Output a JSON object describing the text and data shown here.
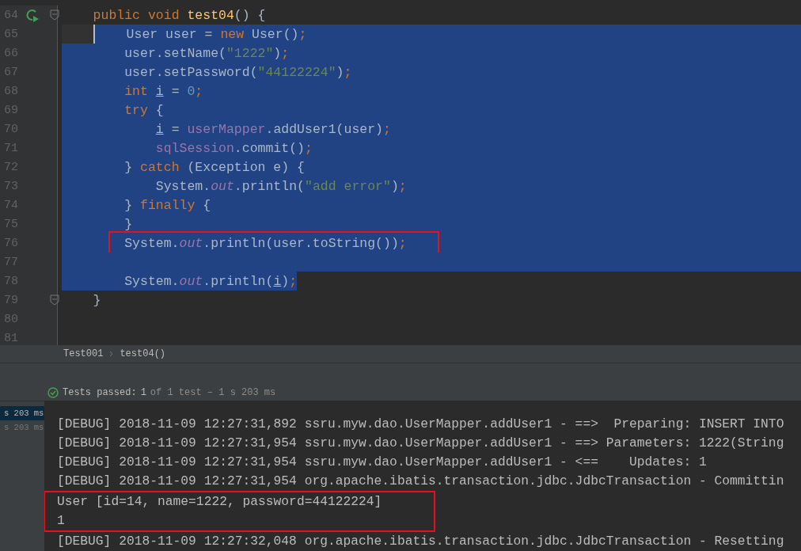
{
  "editor": {
    "lines": [
      {
        "number": "64",
        "run_icon": true,
        "fold": true,
        "caret": false,
        "selected": false,
        "boxed": false,
        "tokens": [
          {
            "kind": "kw",
            "t": "    public"
          },
          {
            "kind": "kw",
            "t": " void"
          },
          {
            "kind": "decl",
            "t": " test04"
          },
          {
            "kind": "p",
            "t": "() {"
          }
        ]
      },
      {
        "number": "65",
        "run_icon": false,
        "fold": false,
        "caret": true,
        "selected": true,
        "boxed": false,
        "tokens": [
          {
            "kind": "p",
            "t": "    User user = "
          },
          {
            "kind": "kw",
            "t": "new"
          },
          {
            "kind": "p",
            "t": " User()"
          },
          {
            "kind": "kw",
            "t": ";"
          }
        ]
      },
      {
        "number": "66",
        "run_icon": false,
        "fold": false,
        "caret": false,
        "selected": true,
        "boxed": false,
        "tokens": [
          {
            "kind": "p",
            "t": "        user.setName("
          },
          {
            "kind": "str",
            "t": "\"1222\""
          },
          {
            "kind": "p",
            "t": ")"
          },
          {
            "kind": "kw",
            "t": ";"
          }
        ]
      },
      {
        "number": "67",
        "run_icon": false,
        "fold": false,
        "caret": false,
        "selected": true,
        "boxed": false,
        "tokens": [
          {
            "kind": "p",
            "t": "        user.setPassword("
          },
          {
            "kind": "str",
            "t": "\"44122224\""
          },
          {
            "kind": "p",
            "t": ")"
          },
          {
            "kind": "kw",
            "t": ";"
          }
        ]
      },
      {
        "number": "68",
        "run_icon": false,
        "fold": false,
        "caret": false,
        "selected": true,
        "boxed": false,
        "tokens": [
          {
            "kind": "kw",
            "t": "        int"
          },
          {
            "kind": "var",
            "t": " i"
          },
          {
            "kind": "p",
            "t": " = "
          },
          {
            "kind": "num",
            "t": "0"
          },
          {
            "kind": "kw",
            "t": ";"
          }
        ]
      },
      {
        "number": "69",
        "run_icon": false,
        "fold": false,
        "caret": false,
        "selected": true,
        "boxed": false,
        "tokens": [
          {
            "kind": "kw",
            "t": "        try"
          },
          {
            "kind": "p",
            "t": " {"
          }
        ]
      },
      {
        "number": "70",
        "run_icon": false,
        "fold": false,
        "caret": false,
        "selected": true,
        "boxed": false,
        "tokens": [
          {
            "kind": "var",
            "t": "            i"
          },
          {
            "kind": "p",
            "t": " = "
          },
          {
            "kind": "field",
            "t": "userMapper"
          },
          {
            "kind": "p",
            "t": ".addUser1(user)"
          },
          {
            "kind": "kw",
            "t": ";"
          }
        ]
      },
      {
        "number": "71",
        "run_icon": false,
        "fold": false,
        "caret": false,
        "selected": true,
        "boxed": false,
        "tokens": [
          {
            "kind": "field",
            "t": "            sqlSession"
          },
          {
            "kind": "p",
            "t": ".commit()"
          },
          {
            "kind": "kw",
            "t": ";"
          }
        ]
      },
      {
        "number": "72",
        "run_icon": false,
        "fold": false,
        "caret": false,
        "selected": true,
        "boxed": false,
        "tokens": [
          {
            "kind": "p",
            "t": "        } "
          },
          {
            "kind": "kw",
            "t": "catch"
          },
          {
            "kind": "p",
            "t": " (Exception e) {"
          }
        ]
      },
      {
        "number": "73",
        "run_icon": false,
        "fold": false,
        "caret": false,
        "selected": true,
        "boxed": false,
        "tokens": [
          {
            "kind": "p",
            "t": "            System."
          },
          {
            "kind": "static",
            "t": "out"
          },
          {
            "kind": "p",
            "t": ".println("
          },
          {
            "kind": "str",
            "t": "\"add error\""
          },
          {
            "kind": "p",
            "t": ")"
          },
          {
            "kind": "kw",
            "t": ";"
          }
        ]
      },
      {
        "number": "74",
        "run_icon": false,
        "fold": false,
        "caret": false,
        "selected": true,
        "boxed": false,
        "tokens": [
          {
            "kind": "p",
            "t": "        } "
          },
          {
            "kind": "kw",
            "t": "finally"
          },
          {
            "kind": "p",
            "t": " {"
          }
        ]
      },
      {
        "number": "75",
        "run_icon": false,
        "fold": false,
        "caret": false,
        "selected": true,
        "boxed": false,
        "tokens": [
          {
            "kind": "p",
            "t": "        }"
          }
        ]
      },
      {
        "number": "76",
        "run_icon": false,
        "fold": false,
        "caret": false,
        "selected": true,
        "boxed": true,
        "tokens": [
          {
            "kind": "p",
            "t": "        System."
          },
          {
            "kind": "static",
            "t": "out"
          },
          {
            "kind": "p",
            "t": ".println(user.toString())"
          },
          {
            "kind": "kw",
            "t": ";"
          }
        ]
      },
      {
        "number": "77",
        "run_icon": false,
        "fold": false,
        "caret": false,
        "selected": true,
        "boxed": false
      },
      {
        "number": "78",
        "run_icon": false,
        "fold": false,
        "caret": false,
        "selected": true,
        "selection_end": true,
        "boxed": false,
        "tokens": [
          {
            "kind": "p",
            "t": "        System."
          },
          {
            "kind": "static",
            "t": "out"
          },
          {
            "kind": "p",
            "t": ".println("
          },
          {
            "kind": "var",
            "t": "i"
          },
          {
            "kind": "p",
            "t": ")"
          },
          {
            "kind": "kw",
            "t": ";"
          }
        ]
      },
      {
        "number": "79",
        "run_icon": false,
        "fold": true,
        "caret": false,
        "selected": false,
        "boxed": false,
        "tokens": [
          {
            "kind": "p",
            "t": "    }"
          }
        ]
      },
      {
        "number": "80",
        "run_icon": false,
        "fold": false,
        "caret": false,
        "selected": false,
        "boxed": false
      },
      {
        "number": "81",
        "run_icon": false,
        "fold": false,
        "caret": false,
        "selected": false,
        "boxed": false
      }
    ]
  },
  "breadcrumb": [
    "Test001",
    "test04()"
  ],
  "run_status": {
    "label": "Tests passed:",
    "count": "1",
    "detail": "of 1 test – 1 s 203 ms"
  },
  "test_tree": [
    {
      "label": "s 203 ms",
      "selected": true
    },
    {
      "label": "s 203 ms",
      "selected": false
    }
  ],
  "console": [
    {
      "text": "[DEBUG] 2018-11-09 12:27:31,892 ssru.myw.dao.UserMapper.addUser1 - ==>  Preparing: INSERT INTO",
      "boxed": false
    },
    {
      "text": "[DEBUG] 2018-11-09 12:27:31,954 ssru.myw.dao.UserMapper.addUser1 - ==> Parameters: 1222(String",
      "boxed": false
    },
    {
      "text": "[DEBUG] 2018-11-09 12:27:31,954 ssru.myw.dao.UserMapper.addUser1 - <==    Updates: 1",
      "boxed": false
    },
    {
      "text": "[DEBUG] 2018-11-09 12:27:31,954 org.apache.ibatis.transaction.jdbc.JdbcTransaction - Committin",
      "boxed": false
    },
    {
      "text": "User [id=14, name=1222, password=44122224]",
      "boxed": true
    },
    {
      "text": "1",
      "boxed": true
    },
    {
      "text": "[DEBUG] 2018-11-09 12:27:32,048 org.apache.ibatis.transaction.jdbc.JdbcTransaction - Resetting",
      "boxed": false
    }
  ]
}
